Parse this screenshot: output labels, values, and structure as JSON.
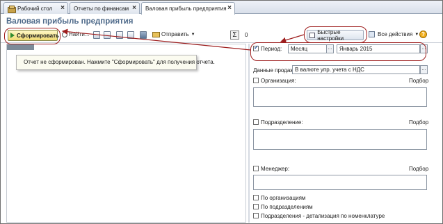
{
  "tabs": [
    {
      "label": "Рабочий стол"
    },
    {
      "label": "Отчеты по финансам"
    },
    {
      "label": "Валовая прибыль предприятия"
    }
  ],
  "page_title": "Валовая прибыль предприятия",
  "toolbar": {
    "run_label": "Сформировать",
    "find_label": "Найти...",
    "send_label": "Отправить",
    "sum_symbol": "Σ",
    "sum_value": "0",
    "quick_settings_label": "Быстрые настройки",
    "all_actions_label": "Все действия",
    "help_label": "?"
  },
  "report": {
    "message": "Отчет не сформирован. Нажмите \"Сформировать\" для получения отчета."
  },
  "settings": {
    "period_label": "Период:",
    "period_checked": true,
    "period_kind": "Месяц",
    "period_value": "Январь 2015",
    "sales_data_label": "Данные продаж:",
    "sales_data_value": "В валюте упр. учета с НДС",
    "organization_label": "Организация:",
    "organization_select": "Подбор",
    "division_label": "Подразделение:",
    "division_select": "Подбор",
    "manager_label": "Менеджер:",
    "manager_select": "Подбор",
    "by_organizations_label": "По организациям",
    "by_divisions_label": "По подразделениям",
    "by_divisions_detail_label": "Подразделения - детализация по номенклатуре",
    "ellipsis": "..."
  },
  "colors": {
    "title": "#4e6a8a",
    "annotation": "#9e1e1e",
    "run_button": "#f1db72"
  }
}
